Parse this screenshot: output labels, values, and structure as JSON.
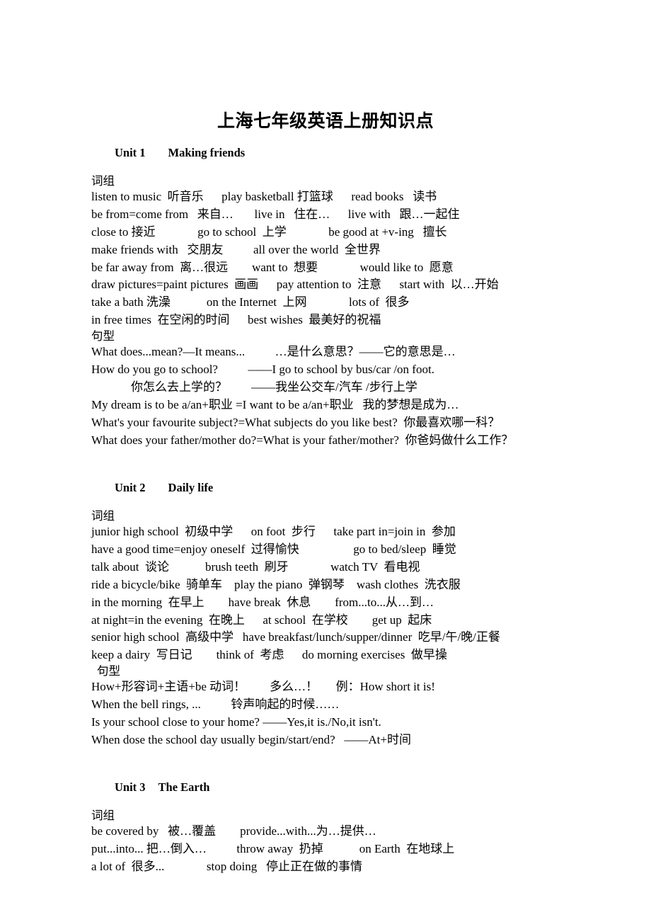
{
  "document": {
    "title": "上海七年级英语上册知识点",
    "phrases_label": "词组",
    "patterns_label": "句型"
  },
  "units": [
    {
      "number": "Unit 1",
      "name": "Making friends",
      "phrases_label": "词组",
      "phrases": [
        "listen to music  听音乐      play basketball 打篮球      read books   读书",
        "be from=come from   来自…       live in   住在…      live with   跟…一起住",
        "close to 接近              go to school  上学              be good at +v-ing   擅长",
        "make friends with   交朋友          all over the world  全世界",
        "be far away from  离…很远        want to  想要              would like to  愿意",
        "draw pictures=paint pictures  画画      pay attention to  注意      start with  以…开始",
        "take a bath 洗澡            on the Internet  上网              lots of  很多",
        "in free times  在空闲的时间      best wishes  最美好的祝福"
      ],
      "patterns_label": "句型",
      "patterns": [
        {
          "text": "What does...mean?—It means...          …是什么意思？——它的意思是…",
          "indent": false
        },
        {
          "text": "How do you go to school?          ——I go to school by bus/car /on foot.",
          "indent": false
        },
        {
          "text": "你怎么去上学的？        ——我坐公交车/汽车 /步行上学",
          "indent": true
        },
        {
          "text": "My dream is to be a/an+职业 =I want to be a/an+职业   我的梦想是成为…",
          "indent": false
        },
        {
          "text": "What's your favourite subject?=What subjects do you like best?  你最喜欢哪一科？",
          "indent": false
        },
        {
          "text": "What does your father/mother do?=What is your father/mother?  你爸妈做什么工作？",
          "indent": false
        }
      ]
    },
    {
      "number": "Unit 2",
      "name": "Daily life",
      "phrases_label": "词组",
      "phrases": [
        "junior high school  初级中学      on foot  步行      take part in=join in  参加",
        "have a good time=enjoy oneself  过得愉快                  go to bed/sleep  睡觉",
        "talk about  谈论            brush teeth  刷牙              watch TV  看电视",
        "ride a bicycle/bike  骑单车    play the piano  弹钢琴    wash clothes  洗衣服",
        "in the morning  在早上        have break  休息        from...to...从…到…",
        "at night=in the evening  在晚上      at school  在学校        get up  起床",
        "senior high school  高级中学   have breakfast/lunch/supper/dinner  吃早/午/晚/正餐",
        "keep a dairy  写日记        think of  考虑      do morning exercises  做早操"
      ],
      "patterns_label": "句型",
      "patterns_indent": true,
      "patterns": [
        {
          "text": "How+形容词+主语+be 动词！        多么…！      例：How short it is!",
          "indent": false
        },
        {
          "text": "When the bell rings, ...          铃声响起的时候……",
          "indent": false
        },
        {
          "text": "Is your school close to your home? ——Yes,it is./No,it isn't.",
          "indent": false
        },
        {
          "text": "When dose the school day usually begin/start/end?   ——At+时间",
          "indent": false
        }
      ]
    },
    {
      "number": "Unit 3",
      "name": "The Earth",
      "phrases_label": "词组",
      "phrases": [
        "be covered by   被…覆盖        provide...with...为…提供…",
        "put...into... 把…倒入…          throw away  扔掉            on Earth  在地球上",
        "a lot of  很多...              stop doing   停止正在做的事情"
      ],
      "patterns_label": "",
      "patterns": []
    }
  ]
}
